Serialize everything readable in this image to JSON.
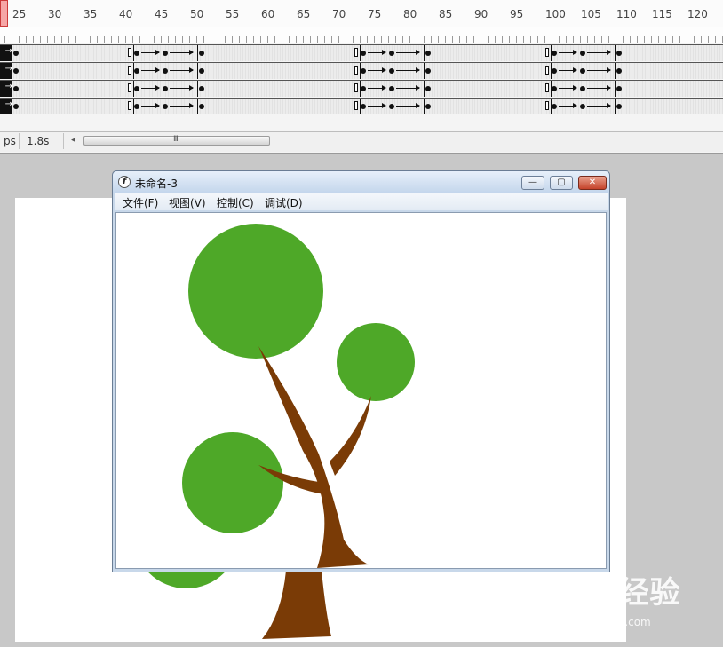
{
  "timeline": {
    "ruler_numbers": [
      "25",
      "30",
      "35",
      "40",
      "45",
      "50",
      "55",
      "60",
      "65",
      "70",
      "75",
      "80",
      "85",
      "90",
      "95",
      "100",
      "105",
      "110",
      "115",
      "120"
    ],
    "layers_count_label": "",
    "status": {
      "fps_fragment": "ps",
      "time": "1.8s",
      "scroll_grip": "III"
    }
  },
  "player": {
    "title": "未命名-3",
    "menu": [
      "文件(F)",
      "视图(V)",
      "控制(C)",
      "调试(D)"
    ],
    "controls": {
      "minimize": "—",
      "restore": "▢",
      "close": "✕"
    },
    "icon_glyph": "f"
  },
  "scene": {
    "colors": {
      "foliage": "#4ea828",
      "trunk": "#7a3b06"
    }
  },
  "watermark": {
    "brand": "Bai 经验",
    "url": "jingyan.baidu.com"
  }
}
